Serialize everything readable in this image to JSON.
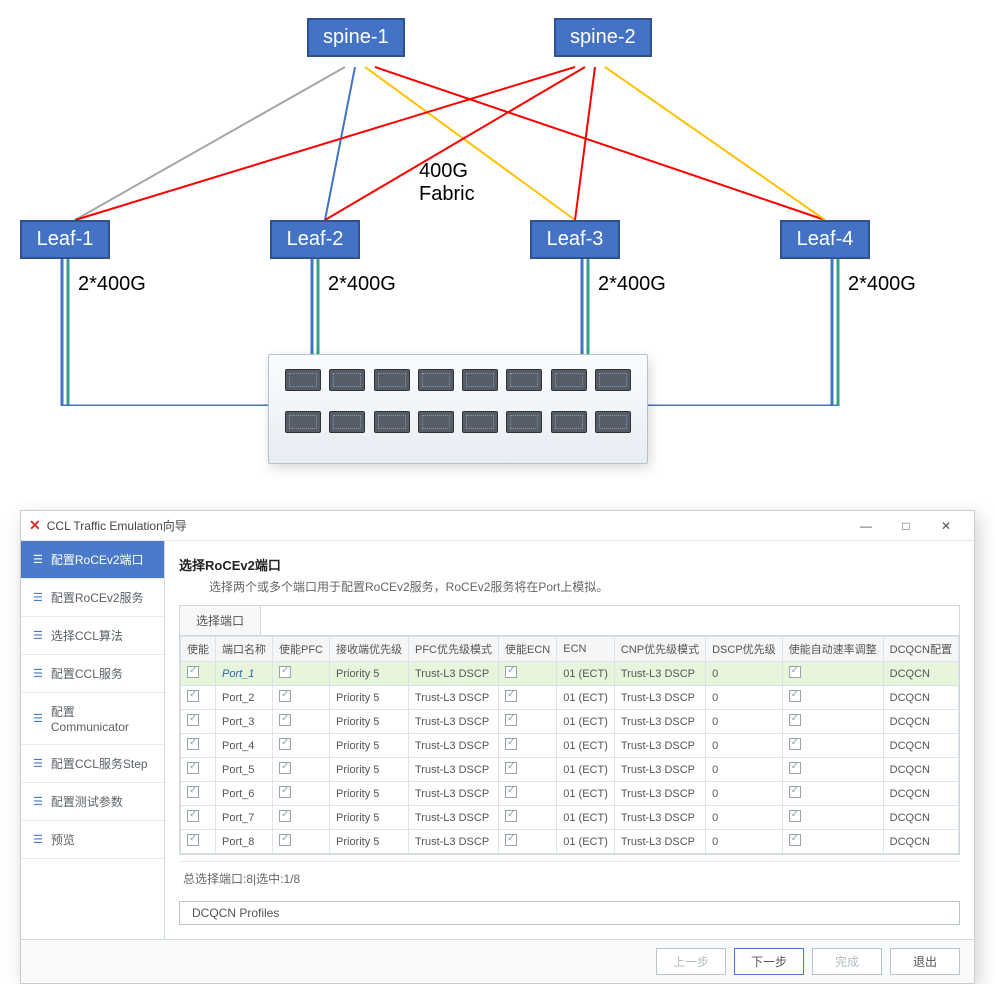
{
  "topology": {
    "fabric_label": "400G\nFabric",
    "spines": [
      "spine-1",
      "spine-2"
    ],
    "leaves": [
      "Leaf-1",
      "Leaf-2",
      "Leaf-3",
      "Leaf-4"
    ],
    "leaf_link_label": "2*400G"
  },
  "window": {
    "title": "CCL Traffic Emulation向导",
    "minimize": "—",
    "maximize": "□",
    "close": "✕",
    "section_title": "选择RoCEv2端口",
    "section_desc": "选择两个或多个端口用于配置RoCEv2服务，RoCEv2服务将在Port上模拟。",
    "tab_label": "选择端口",
    "status_text": "总选择端口:8|选中:1/8",
    "profiles_btn": "DCQCN Profiles"
  },
  "sidebar": [
    "配置RoCEv2端口",
    "配置RoCEv2服务",
    "选择CCL算法",
    "配置CCL服务",
    "配置Communicator",
    "配置CCL服务Step",
    "配置测试参数",
    "预览"
  ],
  "columns": [
    "使能",
    "端口名称",
    "使能PFC",
    "接收端优先级",
    "PFC优先级模式",
    "使能ECN",
    "ECN",
    "CNP优先级模式",
    "DSCP优先级",
    "使能自动速率调整",
    "DCQCN配置"
  ],
  "rows": [
    {
      "name": "Port_1",
      "prio": "Priority 5",
      "pfcmode": "Trust-L3 DSCP",
      "ecn": "01 (ECT)",
      "cnp": "Trust-L3 DSCP",
      "dscp": "0",
      "dcqcn": "DCQCN",
      "sel": true
    },
    {
      "name": "Port_2",
      "prio": "Priority 5",
      "pfcmode": "Trust-L3 DSCP",
      "ecn": "01 (ECT)",
      "cnp": "Trust-L3 DSCP",
      "dscp": "0",
      "dcqcn": "DCQCN",
      "sel": false
    },
    {
      "name": "Port_3",
      "prio": "Priority 5",
      "pfcmode": "Trust-L3 DSCP",
      "ecn": "01 (ECT)",
      "cnp": "Trust-L3 DSCP",
      "dscp": "0",
      "dcqcn": "DCQCN",
      "sel": false
    },
    {
      "name": "Port_4",
      "prio": "Priority 5",
      "pfcmode": "Trust-L3 DSCP",
      "ecn": "01 (ECT)",
      "cnp": "Trust-L3 DSCP",
      "dscp": "0",
      "dcqcn": "DCQCN",
      "sel": false
    },
    {
      "name": "Port_5",
      "prio": "Priority 5",
      "pfcmode": "Trust-L3 DSCP",
      "ecn": "01 (ECT)",
      "cnp": "Trust-L3 DSCP",
      "dscp": "0",
      "dcqcn": "DCQCN",
      "sel": false
    },
    {
      "name": "Port_6",
      "prio": "Priority 5",
      "pfcmode": "Trust-L3 DSCP",
      "ecn": "01 (ECT)",
      "cnp": "Trust-L3 DSCP",
      "dscp": "0",
      "dcqcn": "DCQCN",
      "sel": false
    },
    {
      "name": "Port_7",
      "prio": "Priority 5",
      "pfcmode": "Trust-L3 DSCP",
      "ecn": "01 (ECT)",
      "cnp": "Trust-L3 DSCP",
      "dscp": "0",
      "dcqcn": "DCQCN",
      "sel": false
    },
    {
      "name": "Port_8",
      "prio": "Priority 5",
      "pfcmode": "Trust-L3 DSCP",
      "ecn": "01 (ECT)",
      "cnp": "Trust-L3 DSCP",
      "dscp": "0",
      "dcqcn": "DCQCN",
      "sel": false
    }
  ],
  "footer_buttons": {
    "prev": "上一步",
    "next": "下一步",
    "finish": "完成",
    "exit": "退出"
  }
}
